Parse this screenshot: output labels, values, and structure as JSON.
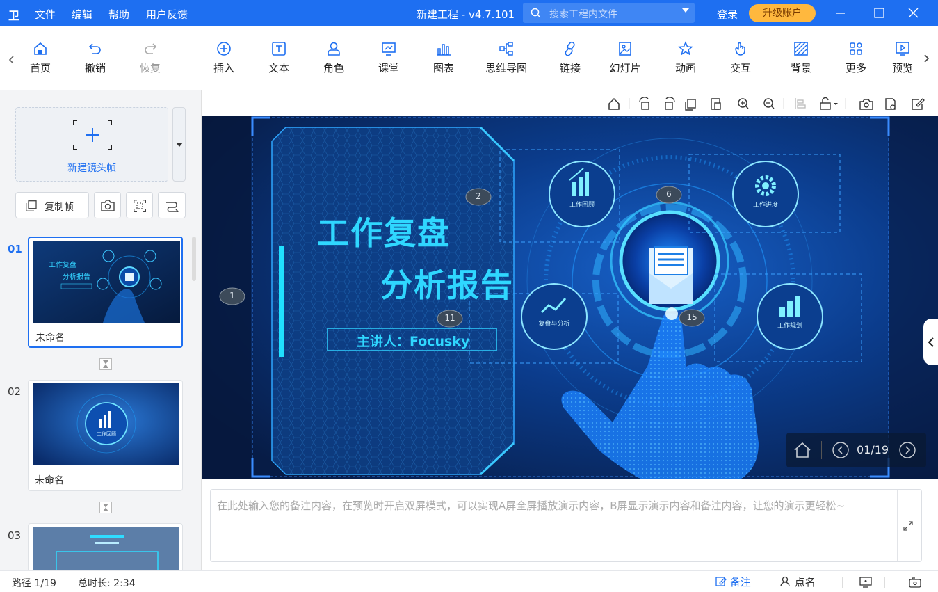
{
  "titlebar": {
    "logo": "卫",
    "menu": [
      "文件",
      "编辑",
      "帮助",
      "用户反馈"
    ],
    "title": "新建工程 - v4.7.101",
    "search_placeholder": "搜索工程内文件",
    "login": "登录",
    "upgrade": "升级账户",
    "colors": {
      "bar": "#1e6ff1",
      "upgrade": "#ffb83e"
    }
  },
  "toolbar": {
    "items": [
      {
        "label": "首页",
        "icon": "home-icon"
      },
      {
        "label": "撤销",
        "icon": "undo-icon"
      },
      {
        "label": "恢复",
        "icon": "redo-icon",
        "disabled": true
      },
      {
        "label": "插入",
        "icon": "plus-circle-icon"
      },
      {
        "label": "文本",
        "icon": "text-icon"
      },
      {
        "label": "角色",
        "icon": "character-icon"
      },
      {
        "label": "课堂",
        "icon": "classroom-icon"
      },
      {
        "label": "图表",
        "icon": "chart-icon"
      },
      {
        "label": "思维导图",
        "icon": "mindmap-icon"
      },
      {
        "label": "链接",
        "icon": "link-icon"
      },
      {
        "label": "幻灯片",
        "icon": "slides-icon"
      },
      {
        "label": "动画",
        "icon": "star-icon"
      },
      {
        "label": "交互",
        "icon": "hand-icon"
      },
      {
        "label": "背景",
        "icon": "background-icon"
      },
      {
        "label": "更多",
        "icon": "grid-icon"
      },
      {
        "label": "预览",
        "icon": "play-icon"
      }
    ]
  },
  "sidebar": {
    "new_frame": "新建镜头帧",
    "copy_frame": "复制帧",
    "frames": [
      {
        "num": "01",
        "name": "未命名"
      },
      {
        "num": "02",
        "name": "未命名"
      },
      {
        "num": "03",
        "name": ""
      }
    ]
  },
  "slide": {
    "title_line1": "工作复盘",
    "title_line2": "分析报告",
    "presenter": "主讲人：Focusky",
    "markers": [
      "1",
      "2",
      "6",
      "11",
      "15"
    ],
    "icons": [
      {
        "label": "工作回顾",
        "icon": "bar-chart-icon"
      },
      {
        "label": "工作进度",
        "icon": "gear-icon"
      },
      {
        "label": "复盘与分析",
        "icon": "line-chart-icon"
      },
      {
        "label": "工作规划",
        "icon": "bar-chart-icon"
      }
    ],
    "nav": {
      "page": "01/19"
    }
  },
  "thumb_text": {
    "t1": "工作复盘",
    "t2": "分析报告",
    "t3": "工作回顾"
  },
  "notes": {
    "placeholder": "在此处输入您的备注内容，在预览时开启双屏模式，可以实现A屏全屏播放演示内容，B屏显示演示内容和备注内容，让您的演示更轻松~"
  },
  "statusbar": {
    "path": "路径 1/19",
    "duration": "总时长: 2:34",
    "notes": "备注",
    "rollcall": "点名"
  }
}
